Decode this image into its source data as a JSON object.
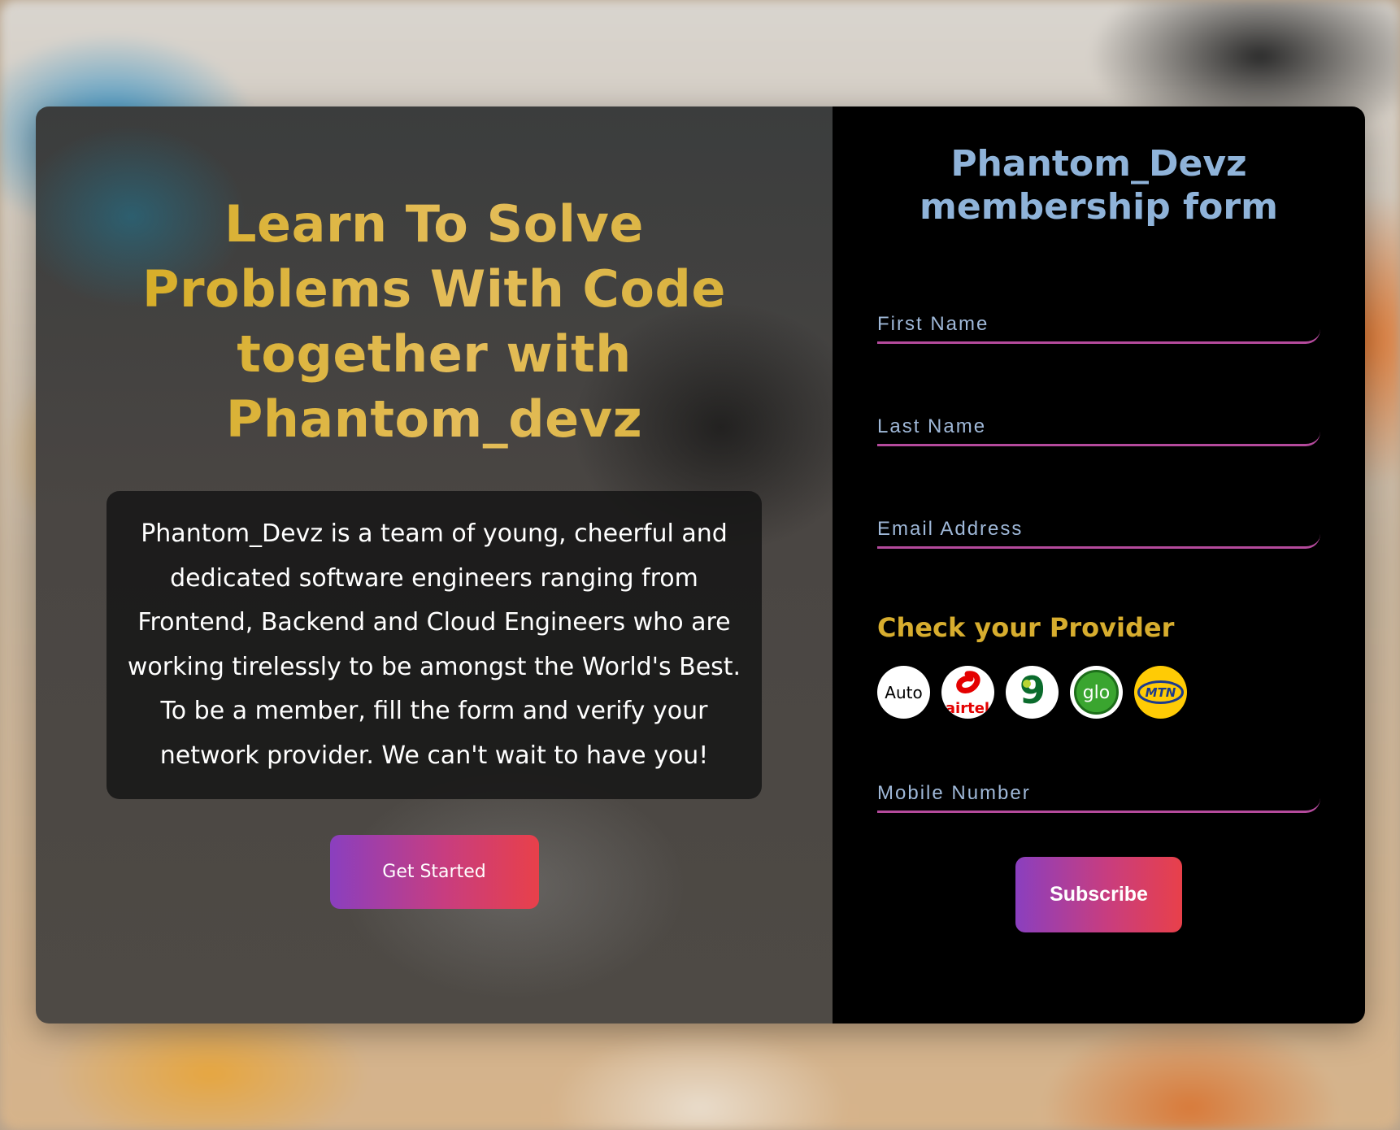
{
  "hero": {
    "headline": "Learn To Solve Problems With Code together with Phantom_devz",
    "about": "Phantom_Devz is a team of young, cheerful and dedicated software engineers ranging from Frontend, Backend and Cloud Engineers who are working tirelessly to be amongst the World's Best. To be a member, fill the form and verify your network provider. We can't wait to have you!",
    "cta_label": "Get Started"
  },
  "form": {
    "title_line1": "Phantom_Devz",
    "title_line2": "membership form",
    "first_name": {
      "placeholder": "First Name",
      "value": ""
    },
    "last_name": {
      "placeholder": "Last Name",
      "value": ""
    },
    "email": {
      "placeholder": "Email Address",
      "value": ""
    },
    "provider_title": "Check your Provider",
    "providers": [
      {
        "name": "auto",
        "label": "Auto"
      },
      {
        "name": "airtel",
        "label": "airtel"
      },
      {
        "name": "9mobile",
        "label": "9"
      },
      {
        "name": "glo",
        "label": "glo"
      },
      {
        "name": "mtn",
        "label": "MTN"
      }
    ],
    "mobile": {
      "placeholder": "Mobile Number",
      "value": ""
    },
    "submit_label": "Subscribe"
  },
  "colors": {
    "headline_gold": "#d6ad26",
    "form_title": "#8fb3d9",
    "underline": "#b44a9c",
    "button_start": "#8a3fbf",
    "button_end": "#e8404a"
  }
}
